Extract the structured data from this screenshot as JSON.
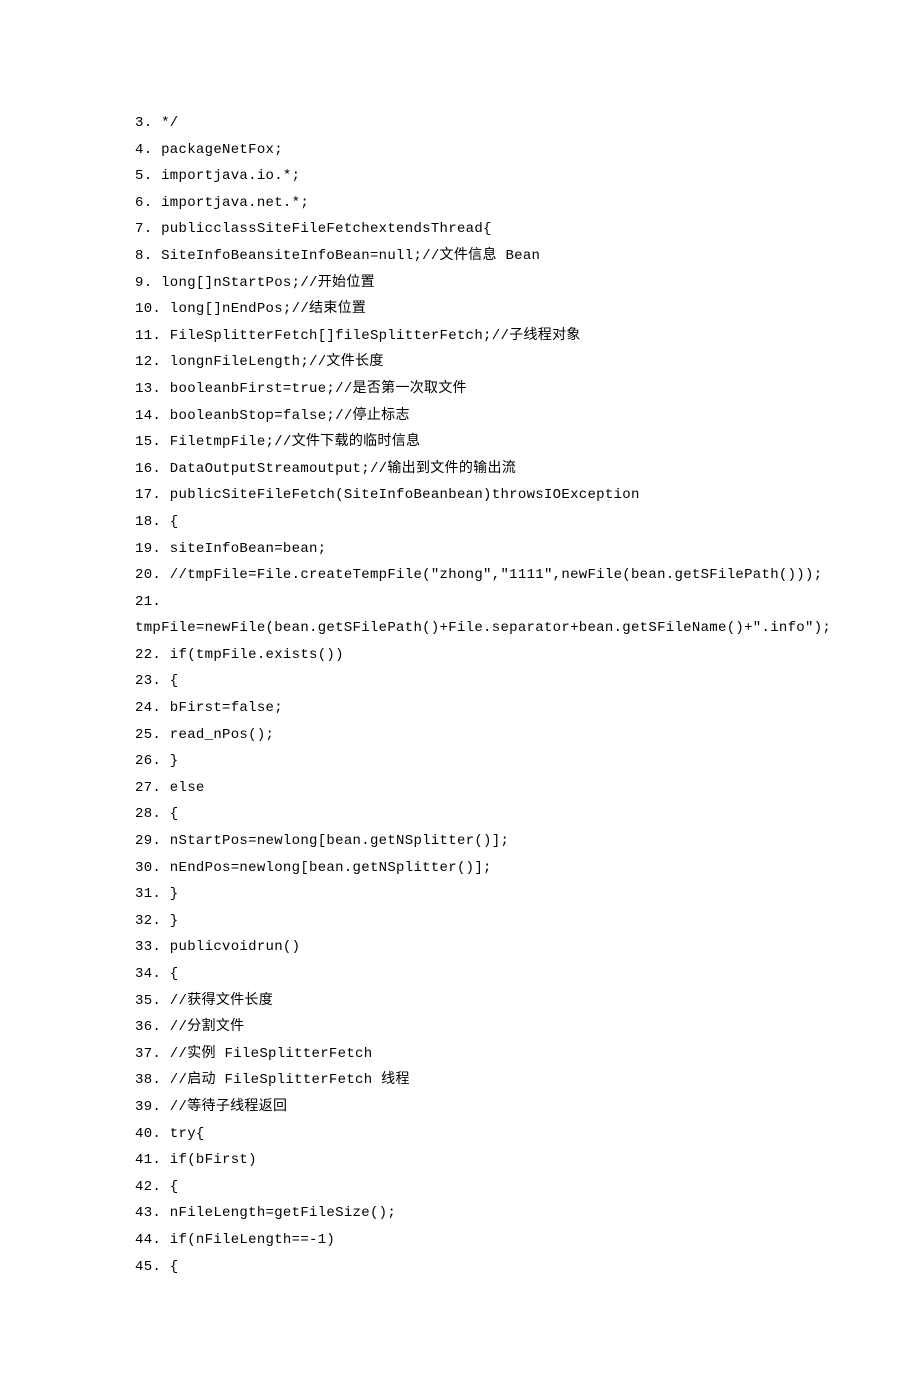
{
  "code_lines": [
    {
      "num": "3.",
      "content": " */"
    },
    {
      "num": "4.",
      "content": " packageNetFox;"
    },
    {
      "num": "5.",
      "content": " importjava.io.*;"
    },
    {
      "num": "6.",
      "content": " importjava.net.*;"
    },
    {
      "num": "7.",
      "content": " publicclassSiteFileFetchextendsThread{"
    },
    {
      "num": "8.",
      "content": " SiteInfoBeansiteInfoBean=null;//文件信息 Bean"
    },
    {
      "num": "9.",
      "content": " long[]nStartPos;//开始位置"
    },
    {
      "num": "10.",
      "content": " long[]nEndPos;//结束位置"
    },
    {
      "num": "11.",
      "content": " FileSplitterFetch[]fileSplitterFetch;//子线程对象"
    },
    {
      "num": "12.",
      "content": " longnFileLength;//文件长度"
    },
    {
      "num": "13.",
      "content": " booleanbFirst=true;//是否第一次取文件"
    },
    {
      "num": "14.",
      "content": " booleanbStop=false;//停止标志"
    },
    {
      "num": "15.",
      "content": " FiletmpFile;//文件下载的临时信息"
    },
    {
      "num": "16.",
      "content": " DataOutputStreamoutput;//输出到文件的输出流"
    },
    {
      "num": "17.",
      "content": " publicSiteFileFetch(SiteInfoBeanbean)throwsIOException"
    },
    {
      "num": "18.",
      "content": " {"
    },
    {
      "num": "19.",
      "content": " siteInfoBean=bean;"
    },
    {
      "num": "20.",
      "content": " //tmpFile=File.createTempFile(\"zhong\",\"1111\",newFile(bean.getSFilePath()));"
    },
    {
      "num": "21.",
      "content": ""
    },
    {
      "num": "",
      "content": "tmpFile=newFile(bean.getSFilePath()+File.separator+bean.getSFileName()+\".info\");"
    },
    {
      "num": "22.",
      "content": " if(tmpFile.exists())"
    },
    {
      "num": "23.",
      "content": " {"
    },
    {
      "num": "24.",
      "content": " bFirst=false;"
    },
    {
      "num": "25.",
      "content": " read_nPos();"
    },
    {
      "num": "26.",
      "content": " }"
    },
    {
      "num": "27.",
      "content": " else"
    },
    {
      "num": "28.",
      "content": " {"
    },
    {
      "num": "29.",
      "content": " nStartPos=newlong[bean.getNSplitter()];"
    },
    {
      "num": "30.",
      "content": " nEndPos=newlong[bean.getNSplitter()];"
    },
    {
      "num": "31.",
      "content": " }"
    },
    {
      "num": "32.",
      "content": " }"
    },
    {
      "num": "33.",
      "content": " publicvoidrun()"
    },
    {
      "num": "34.",
      "content": " {"
    },
    {
      "num": "35.",
      "content": " //获得文件长度"
    },
    {
      "num": "36.",
      "content": " //分割文件"
    },
    {
      "num": "37.",
      "content": " //实例 FileSplitterFetch"
    },
    {
      "num": "38.",
      "content": " //启动 FileSplitterFetch 线程"
    },
    {
      "num": "39.",
      "content": " //等待子线程返回"
    },
    {
      "num": "40.",
      "content": " try{"
    },
    {
      "num": "41.",
      "content": " if(bFirst)"
    },
    {
      "num": "42.",
      "content": " {"
    },
    {
      "num": "43.",
      "content": " nFileLength=getFileSize();"
    },
    {
      "num": "44.",
      "content": " if(nFileLength==-1)"
    },
    {
      "num": "45.",
      "content": " {"
    }
  ]
}
